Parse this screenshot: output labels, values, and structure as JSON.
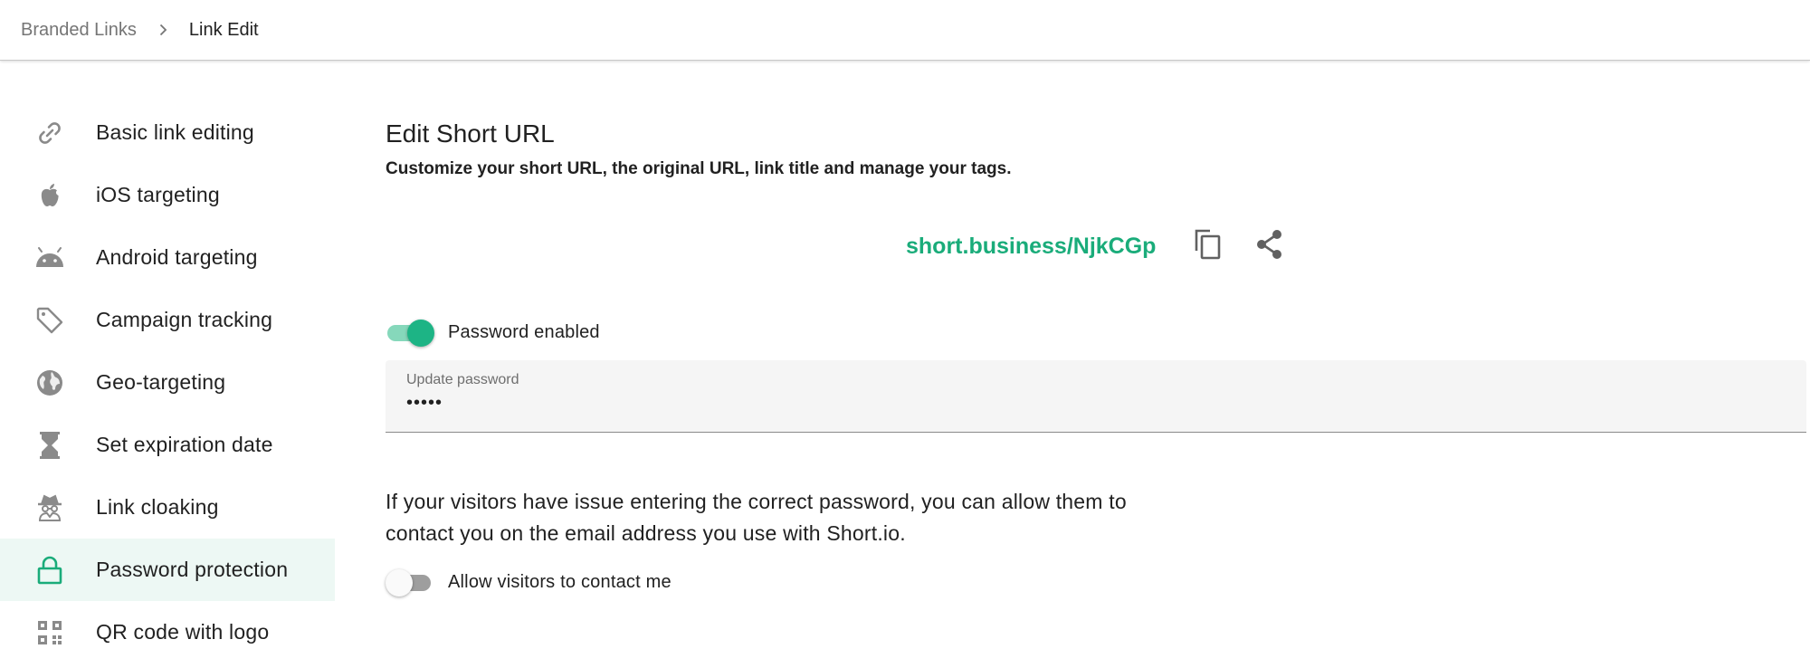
{
  "breadcrumb": {
    "parent": "Branded Links",
    "current": "Link Edit"
  },
  "sidebar": {
    "items": [
      {
        "label": "Basic link editing",
        "icon": "link-icon",
        "active": false
      },
      {
        "label": "iOS targeting",
        "icon": "apple-icon",
        "active": false
      },
      {
        "label": "Android targeting",
        "icon": "android-icon",
        "active": false
      },
      {
        "label": "Campaign tracking",
        "icon": "tag-icon",
        "active": false
      },
      {
        "label": "Geo-targeting",
        "icon": "globe-icon",
        "active": false
      },
      {
        "label": "Set expiration date",
        "icon": "hourglass-icon",
        "active": false
      },
      {
        "label": "Link cloaking",
        "icon": "incognito-icon",
        "active": false
      },
      {
        "label": "Password protection",
        "icon": "lock-icon",
        "active": true
      },
      {
        "label": "QR code with logo",
        "icon": "qr-code-icon",
        "active": false
      }
    ]
  },
  "main": {
    "title": "Edit Short URL",
    "subtitle": "Customize your short URL, the original URL, link title and manage your tags.",
    "short_url": "short.business/NjkCGp",
    "password_toggle": {
      "label": "Password enabled",
      "on": true
    },
    "password_field": {
      "label": "Update password",
      "value": "•••••"
    },
    "info_text": "If your visitors have issue entering the correct password, you can allow them to contact you on the email address you use with Short.io.",
    "contact_toggle": {
      "label": "Allow visitors to contact me",
      "on": false
    }
  },
  "colors": {
    "accent": "#1aac7a",
    "active_bg": "#edf8f4",
    "icon_gray": "#8a8a8a"
  }
}
